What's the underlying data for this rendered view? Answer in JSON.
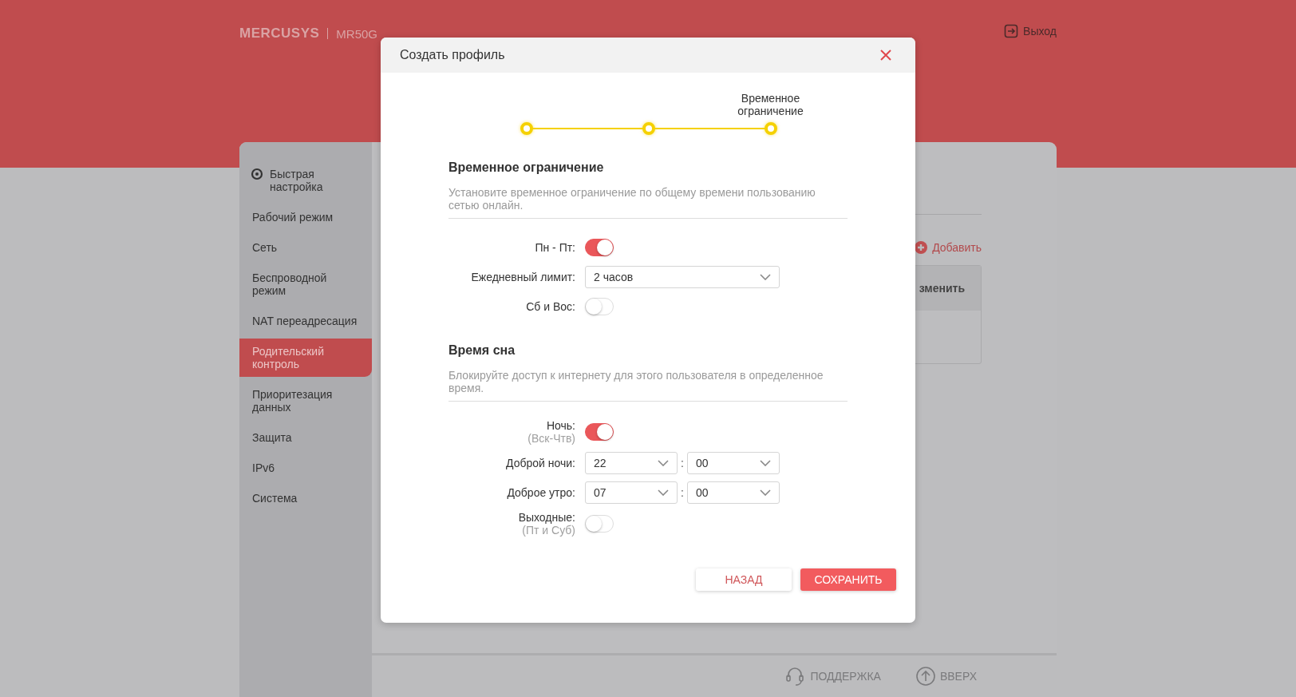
{
  "header": {
    "logo": "MERCUSYS",
    "model": "MR50G",
    "logout": "Выход"
  },
  "sidebar": {
    "items": [
      {
        "label": "Быстрая настройка",
        "kind": "icon",
        "selected": false
      },
      {
        "label": "Рабочий режим",
        "kind": "plain",
        "selected": false
      },
      {
        "label": "Сеть",
        "kind": "plain",
        "selected": false
      },
      {
        "label": "Беспроводной режим",
        "kind": "plain",
        "selected": false
      },
      {
        "label": "NAT переадресация",
        "kind": "plain",
        "selected": false
      },
      {
        "label": "Родительский контроль",
        "kind": "plain",
        "selected": true
      },
      {
        "label": "Приоритезация данных",
        "kind": "plain",
        "selected": false
      },
      {
        "label": "Защита",
        "kind": "plain",
        "selected": false
      },
      {
        "label": "IPv6",
        "kind": "plain",
        "selected": false
      },
      {
        "label": "Система",
        "kind": "plain",
        "selected": false
      }
    ]
  },
  "content": {
    "add_link": "Добавить",
    "table": {
      "columns": [
        "зменить"
      ]
    }
  },
  "footer": {
    "support": "ПОДДЕРЖКА",
    "top": "ВВЕРХ"
  },
  "dialog": {
    "title": "Создать профиль",
    "steps": [
      {
        "done": true
      },
      {
        "done": true
      },
      {
        "done": true,
        "label": "Временное ограничение"
      }
    ],
    "sections": [
      {
        "title": "Временное ограничение",
        "description": "Установите временное ограничение по общему времени пользованию сетью онлайн.",
        "rows": [
          {
            "kind": "toggle",
            "label": "Пн - Пт:",
            "on": true
          },
          {
            "kind": "select",
            "label": "Ежедневный лимит:",
            "value": "2 часов"
          },
          {
            "kind": "toggle",
            "label": "Сб и Вос:",
            "on": false
          }
        ]
      },
      {
        "title": "Время сна",
        "description": "Блокируйте доступ к интернету для этого пользователя в определенное время.",
        "rows": [
          {
            "kind": "toggle",
            "label": "Ночь:",
            "sublabel": "(Вск-Чтв)",
            "on": true
          },
          {
            "kind": "time",
            "label": "Доброй ночи:",
            "values": [
              "22",
              "00"
            ],
            "separator": ":"
          },
          {
            "kind": "time",
            "label": "Доброе утро:",
            "values": [
              "07",
              "00"
            ],
            "separator": ":"
          },
          {
            "kind": "toggle",
            "label": "Выходные:",
            "sublabel": "(Пт и Суб)",
            "on": false
          }
        ]
      }
    ],
    "buttons": [
      {
        "label": "НАЗАД",
        "kind": "secondary"
      },
      {
        "label": "СОХРАНИТЬ",
        "kind": "primary"
      }
    ]
  }
}
